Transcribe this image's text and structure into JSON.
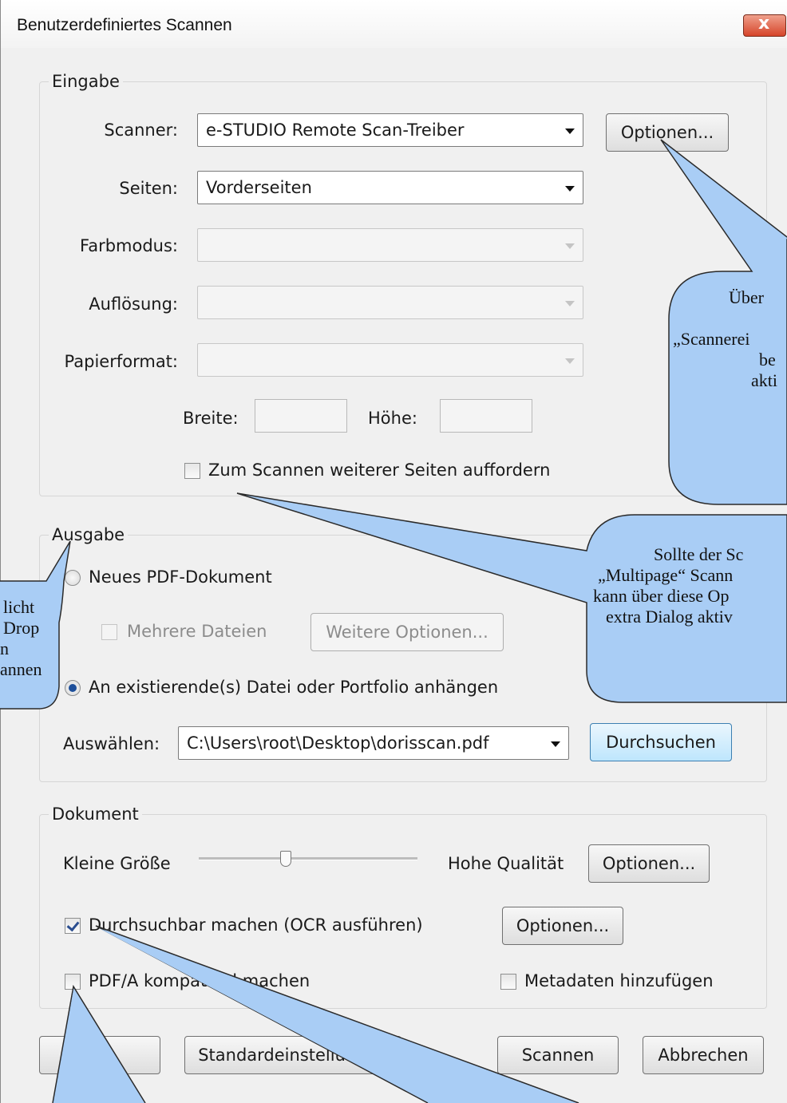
{
  "window": {
    "title": "Benutzerdefiniertes Scannen",
    "close_symbol": "x"
  },
  "eingabe": {
    "label": "Eingabe",
    "scanner_label": "Scanner:",
    "scanner_value": "e-STUDIO  Remote Scan-Treiber",
    "optionen_button": "Optionen...",
    "seiten_label": "Seiten:",
    "seiten_value": "Vorderseiten",
    "farbmodus_label": "Farbmodus:",
    "farbmodus_value": "",
    "aufloesung_label": "Auflösung:",
    "aufloesung_value": "",
    "papierformat_label": "Papierformat:",
    "papierformat_value": "",
    "breite_label": "Breite:",
    "hoehe_label": "Höhe:",
    "weitere_seiten_label": "Zum Scannen weiterer Seiten auffordern",
    "weitere_seiten_checked": false
  },
  "ausgabe": {
    "label": "Ausgabe",
    "neues_pdf_label": "Neues PDF-Dokument",
    "mehrere_dateien_label": "Mehrere Dateien",
    "weitere_optionen_button": "Weitere Optionen...",
    "anhaengen_label": "An existierende(s) Datei oder Portfolio anhängen",
    "selected_option": "anhaengen",
    "auswaehlen_label": "Auswählen:",
    "auswaehlen_value": "C:\\Users\\root\\Desktop\\dorisscan.pdf",
    "durchsuchen_button": "Durchsuchen"
  },
  "dokument": {
    "label": "Dokument",
    "kleine_groesse_label": "Kleine Größe",
    "hohe_qualitaet_label": "Hohe Qualität",
    "qualitaet_optionen_button": "Optionen...",
    "ocr_label": "Durchsuchbar machen (OCR ausführen)",
    "ocr_checked": true,
    "ocr_optionen_button": "Optionen...",
    "pdfa_label": "PDF/A kompatibel machen",
    "pdfa_checked": false,
    "metadaten_label": "Metadaten hinzufügen",
    "metadaten_checked": false
  },
  "footer": {
    "standard_button": "Standardeinstellungen",
    "scannen_button": "Scannen",
    "abbrechen_button": "Abbrechen"
  },
  "callouts": {
    "optionen": {
      "lines": [
        "Über",
        "",
        "„Scannerei",
        "be",
        "akti"
      ]
    },
    "multipage": {
      "lines": [
        "Sollte der Sc",
        "„Multipage“ Scann",
        "kann über diese Op",
        "extra Dialog aktiv"
      ]
    },
    "left": {
      "lines": [
        "licht",
        "Drop",
        "n",
        "annen"
      ]
    }
  },
  "colors": {
    "callout_fill": "#a9cdf5",
    "callout_stroke": "#2a2a2a",
    "accent": "#1d4f9a"
  }
}
